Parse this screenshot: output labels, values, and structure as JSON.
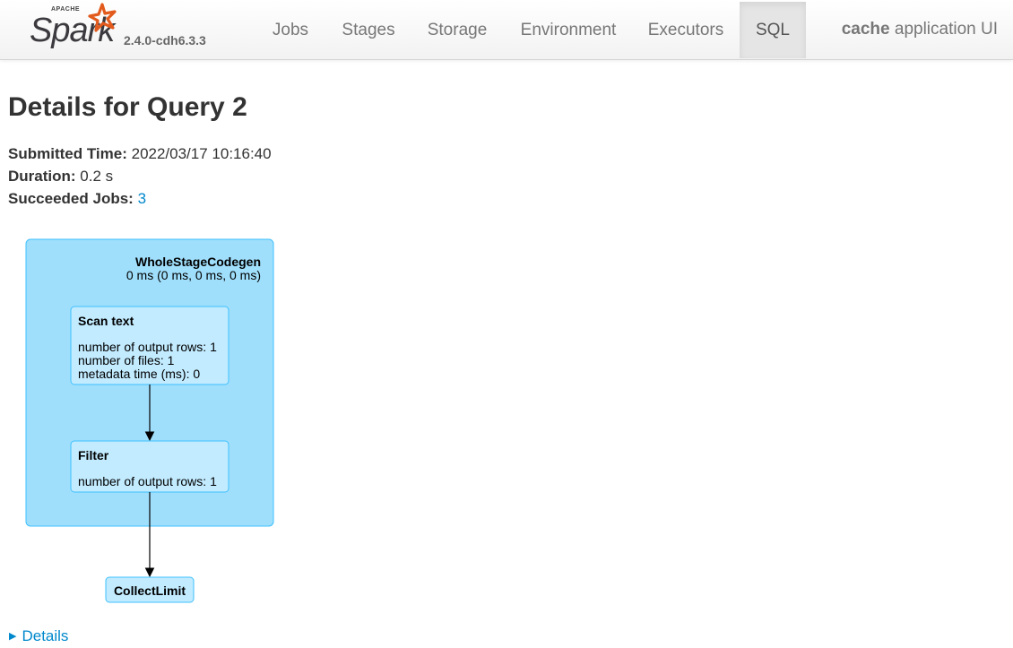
{
  "brand": {
    "apache": "APACHE",
    "name": "Spark",
    "version": "2.4.0-cdh6.3.3"
  },
  "nav": {
    "items": [
      {
        "label": "Jobs",
        "active": false
      },
      {
        "label": "Stages",
        "active": false
      },
      {
        "label": "Storage",
        "active": false
      },
      {
        "label": "Environment",
        "active": false
      },
      {
        "label": "Executors",
        "active": false
      },
      {
        "label": "SQL",
        "active": true
      }
    ],
    "app_name": "cache",
    "app_suffix": "application UI"
  },
  "page": {
    "title": "Details for Query 2",
    "submitted_label": "Submitted Time:",
    "submitted_value": "2022/03/17 10:16:40",
    "duration_label": "Duration:",
    "duration_value": "0.2 s",
    "jobs_label": "Succeeded Jobs:",
    "jobs_value": "3"
  },
  "graph": {
    "cluster": {
      "name": "WholeStageCodegen",
      "metrics": "0 ms (0 ms, 0 ms, 0 ms)"
    },
    "nodes": [
      {
        "name": "Scan text",
        "metrics": [
          "number of output rows: 1",
          "number of files: 1",
          "metadata time (ms): 0"
        ]
      },
      {
        "name": "Filter",
        "metrics": [
          "number of output rows: 1"
        ]
      },
      {
        "name": "CollectLimit",
        "metrics": []
      }
    ],
    "colors": {
      "cluster_fill": "#a0dffc",
      "cluster_stroke": "#3ec0ff",
      "node_fill": "#c2ebff",
      "node_stroke": "#3ec0ff"
    }
  },
  "details_link": "Details",
  "colors": {
    "link": "#0088cc",
    "nav_text": "#777777",
    "brand_orange": "#e25a1c"
  }
}
